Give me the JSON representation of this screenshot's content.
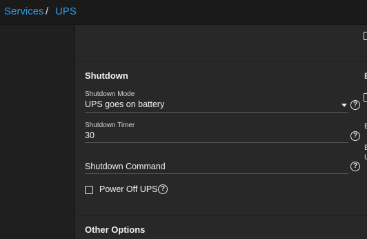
{
  "breadcrumb": {
    "parent": "Services",
    "separator": "/",
    "current": "UPS"
  },
  "shutdown": {
    "title": "Shutdown",
    "mode": {
      "label": "Shutdown Mode",
      "value": "UPS goes on battery"
    },
    "timer": {
      "label": "Shutdown Timer",
      "value": "30"
    },
    "command": {
      "placeholder": "Shutdown Command"
    },
    "power_off": {
      "label": "Power Off UPS",
      "checked": false
    }
  },
  "other_options": {
    "title": "Other Options"
  },
  "help_glyph": "?",
  "edge": {
    "letter_1": "E",
    "letter_2": "E",
    "letter_3": "E",
    "letter_4": "U"
  },
  "colors": {
    "accent": "#2c9be6",
    "background": "#1e1e1e",
    "card": "#282828"
  }
}
